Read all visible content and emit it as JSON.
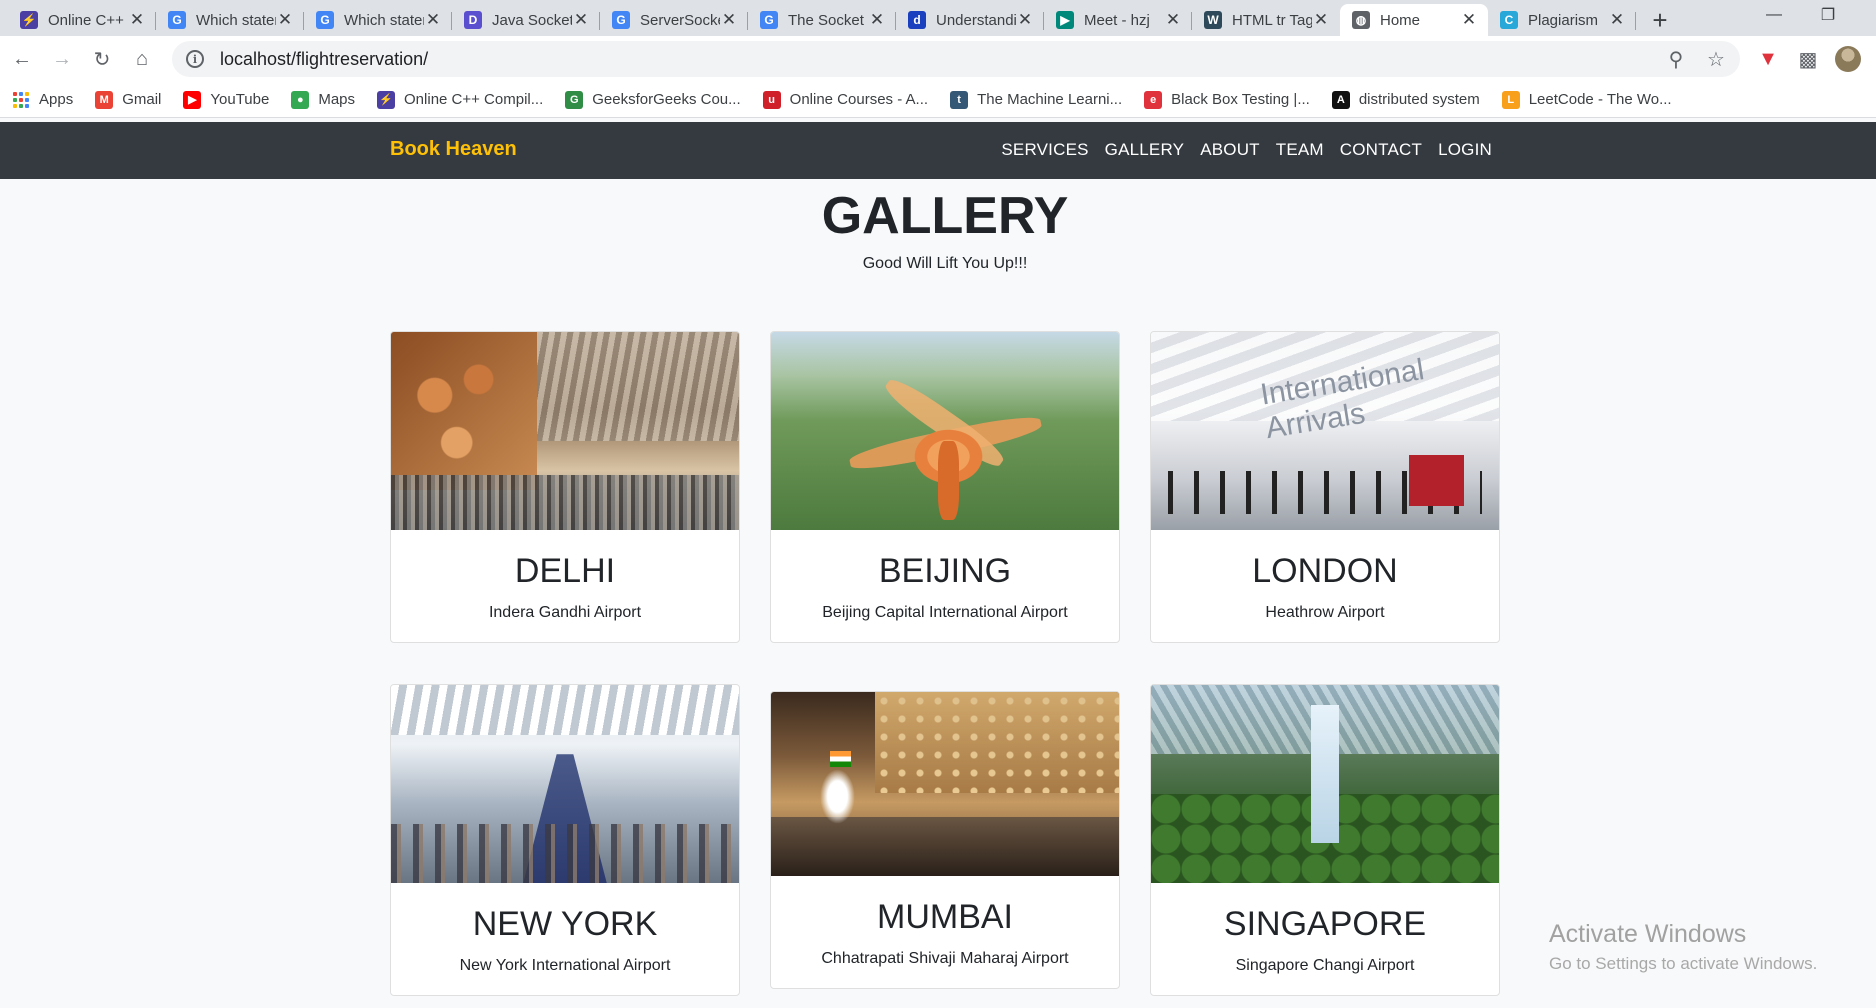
{
  "browser": {
    "tabs": [
      {
        "title": "Online C++ Compiler",
        "icon": "lightning-icon",
        "color": "#4b3fa3",
        "glyph": "⚡"
      },
      {
        "title": "Which statement",
        "icon": "google-icon",
        "color": "#4285f4",
        "glyph": "G"
      },
      {
        "title": "Which statement",
        "icon": "google-icon",
        "color": "#4285f4",
        "glyph": "G"
      },
      {
        "title": "Java Socket",
        "icon": "d-logo-icon",
        "color": "#5a4fcf",
        "glyph": "D"
      },
      {
        "title": "ServerSocket",
        "icon": "google-icon",
        "color": "#4285f4",
        "glyph": "G"
      },
      {
        "title": "The Socket",
        "icon": "google-icon",
        "color": "#4285f4",
        "glyph": "G"
      },
      {
        "title": "Understanding",
        "icon": "d-logo-icon",
        "color": "#1a3fbf",
        "glyph": "d"
      },
      {
        "title": "Meet - hzj",
        "icon": "meet-icon",
        "color": "#00897b",
        "glyph": "▶"
      },
      {
        "title": "HTML tr Tag",
        "icon": "w3-icon",
        "color": "#2e4a5a",
        "glyph": "W"
      },
      {
        "title": "Home",
        "icon": "globe-icon",
        "color": "#5f6368",
        "glyph": "◍"
      },
      {
        "title": "Plagiarism",
        "icon": "c-logo-icon",
        "color": "#27a8d8",
        "glyph": "C"
      }
    ],
    "active_tab_index": 9,
    "url": "localhost/flightreservation/",
    "bookmarks": [
      {
        "label": "Apps",
        "icon": "apps-grid-icon"
      },
      {
        "label": "Gmail",
        "icon": "gmail-icon",
        "color": "#ea4335",
        "glyph": "M"
      },
      {
        "label": "YouTube",
        "icon": "youtube-icon",
        "color": "#ff0000",
        "glyph": "▶"
      },
      {
        "label": "Maps",
        "icon": "maps-icon",
        "color": "#34a853",
        "glyph": "●"
      },
      {
        "label": "Online C++ Compil...",
        "icon": "lightning-icon",
        "color": "#4b3fa3",
        "glyph": "⚡"
      },
      {
        "label": "GeeksforGeeks Cou...",
        "icon": "gfg-icon",
        "color": "#2f8d46",
        "glyph": "G"
      },
      {
        "label": "Online Courses - A...",
        "icon": "udemy-icon",
        "color": "#d0212b",
        "glyph": "u"
      },
      {
        "label": "The Machine Learni...",
        "icon": "tds-icon",
        "color": "#355876",
        "glyph": "t"
      },
      {
        "label": "Black Box Testing |...",
        "icon": "guru-icon",
        "color": "#e0323c",
        "glyph": "e"
      },
      {
        "label": "distributed system",
        "icon": "a-logo-icon",
        "color": "#111111",
        "glyph": "A"
      },
      {
        "label": "LeetCode - The Wo...",
        "icon": "leetcode-icon",
        "color": "#f89f1b",
        "glyph": "L"
      }
    ]
  },
  "site": {
    "brand": "Book Heaven",
    "brand_color": "#ffc107",
    "nav": [
      "SERVICES",
      "GALLERY",
      "ABOUT",
      "TEAM",
      "CONTACT",
      "LOGIN"
    ],
    "title": "GALLERY",
    "subtitle": "Good Will Lift You Up!!!",
    "cards": [
      {
        "city": "DELHI",
        "airport": "Indera Gandhi Airport"
      },
      {
        "city": "BEIJING",
        "airport": "Beijing Capital International Airport"
      },
      {
        "city": "LONDON",
        "airport": "Heathrow Airport"
      },
      {
        "city": "NEW YORK",
        "airport": "New York International Airport"
      },
      {
        "city": "MUMBAI",
        "airport": "Chhatrapati Shivaji Maharaj Airport"
      },
      {
        "city": "SINGAPORE",
        "airport": "Singapore Changi Airport"
      }
    ],
    "london_image_sign": "International Arrivals"
  },
  "watermark": {
    "line1": "Activate Windows",
    "line2": "Go to Settings to activate Windows."
  }
}
